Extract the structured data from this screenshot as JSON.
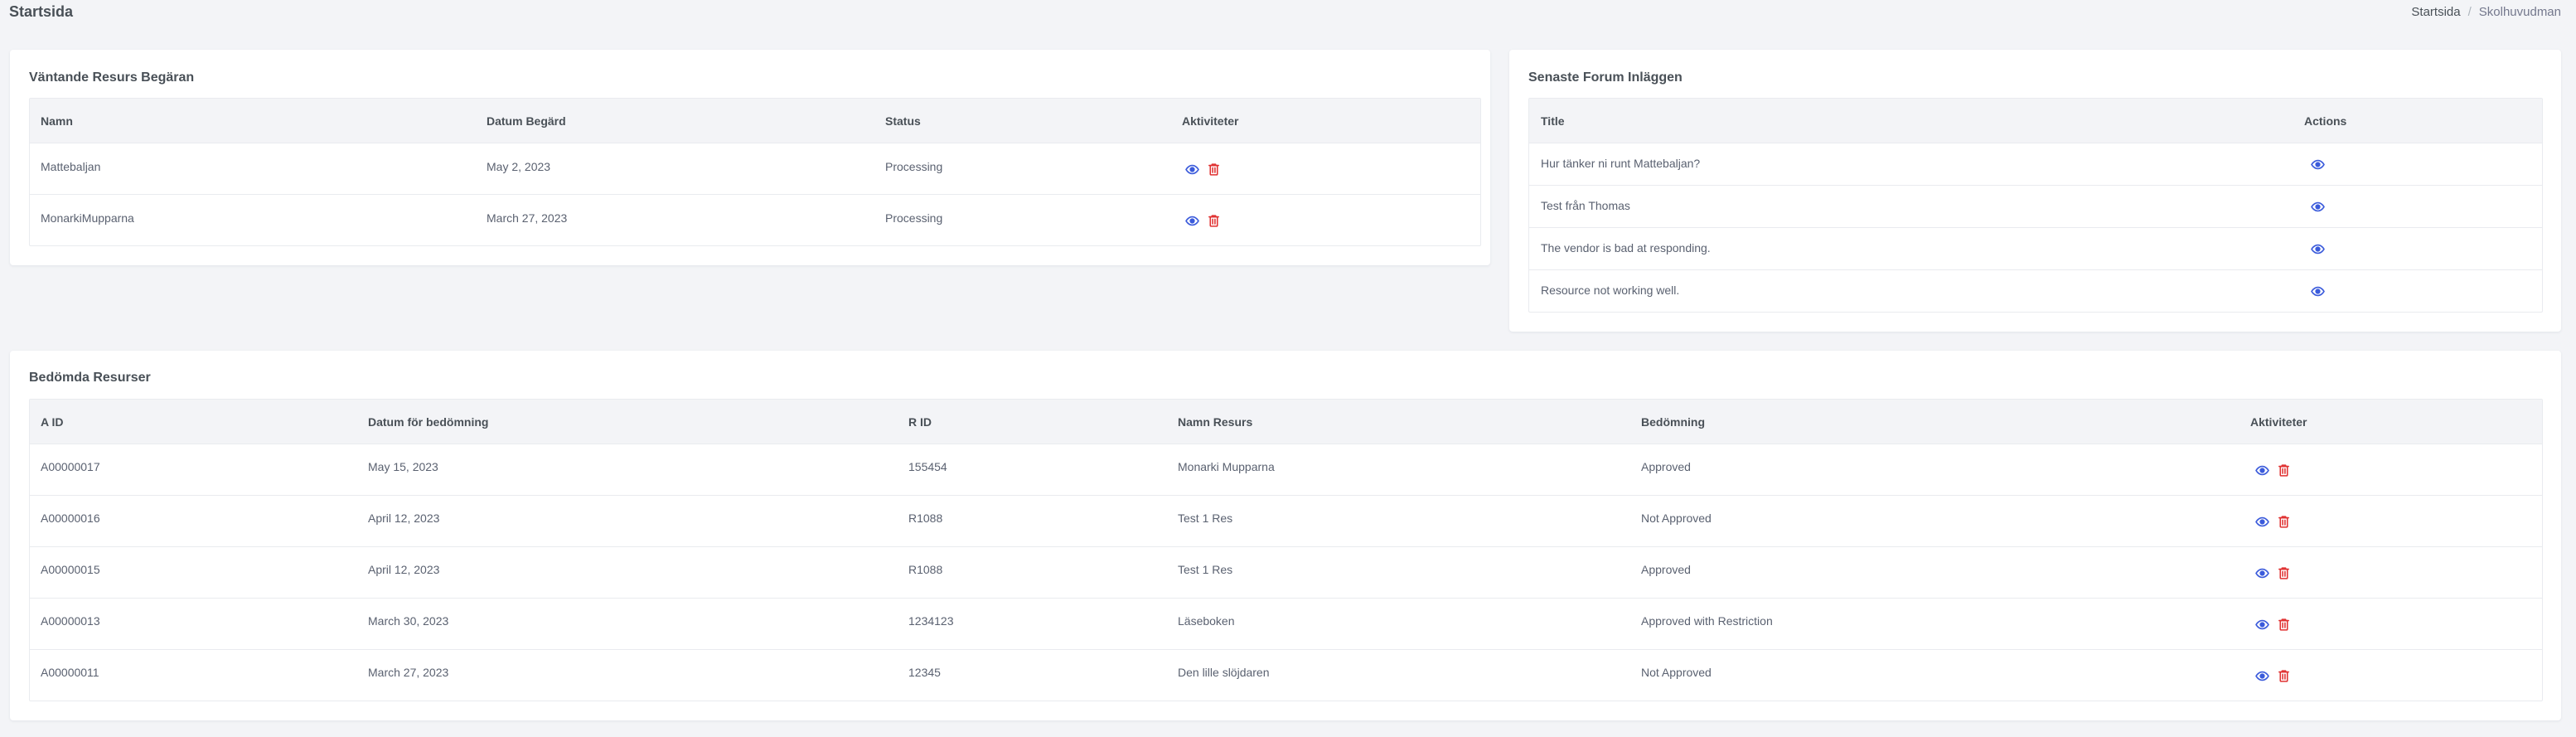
{
  "header": {
    "title": "Startsida",
    "breadcrumb": {
      "home": "Startsida",
      "separator": "/",
      "current": "Skolhuvudman"
    }
  },
  "colors": {
    "view_icon": "#3b5bdb",
    "delete_icon": "#e03131"
  },
  "pending_requests": {
    "title": "Väntande Resurs Begäran",
    "columns": [
      "Namn",
      "Datum Begärd",
      "Status",
      "Aktiviteter"
    ],
    "rows": [
      {
        "name": "Mattebaljan",
        "date": "May 2, 2023",
        "status": "Processing"
      },
      {
        "name": "MonarkiMupparna",
        "date": "March 27, 2023",
        "status": "Processing"
      }
    ]
  },
  "forum": {
    "title": "Senaste Forum Inläggen",
    "columns": [
      "Title",
      "Actions"
    ],
    "rows": [
      {
        "title": "Hur tänker ni runt Mattebaljan?"
      },
      {
        "title": "Test från Thomas"
      },
      {
        "title": "The vendor is bad at responding."
      },
      {
        "title": "Resource not working well."
      }
    ]
  },
  "assessed": {
    "title": "Bedömda Resurser",
    "columns": [
      "A ID",
      "Datum för bedömning",
      "R ID",
      "Namn Resurs",
      "Bedömning",
      "Aktiviteter"
    ],
    "rows": [
      {
        "aid": "A00000017",
        "date": "May 15, 2023",
        "rid": "155454",
        "name": "Monarki Mupparna",
        "assessment": "Approved"
      },
      {
        "aid": "A00000016",
        "date": "April 12, 2023",
        "rid": "R1088",
        "name": "Test 1 Res",
        "assessment": "Not Approved"
      },
      {
        "aid": "A00000015",
        "date": "April 12, 2023",
        "rid": "R1088",
        "name": "Test 1 Res",
        "assessment": "Approved"
      },
      {
        "aid": "A00000013",
        "date": "March 30, 2023",
        "rid": "1234123",
        "name": "Läseboken",
        "assessment": "Approved with Restriction"
      },
      {
        "aid": "A00000011",
        "date": "March 27, 2023",
        "rid": "12345",
        "name": "Den lille slöjdaren",
        "assessment": "Not Approved"
      }
    ]
  }
}
